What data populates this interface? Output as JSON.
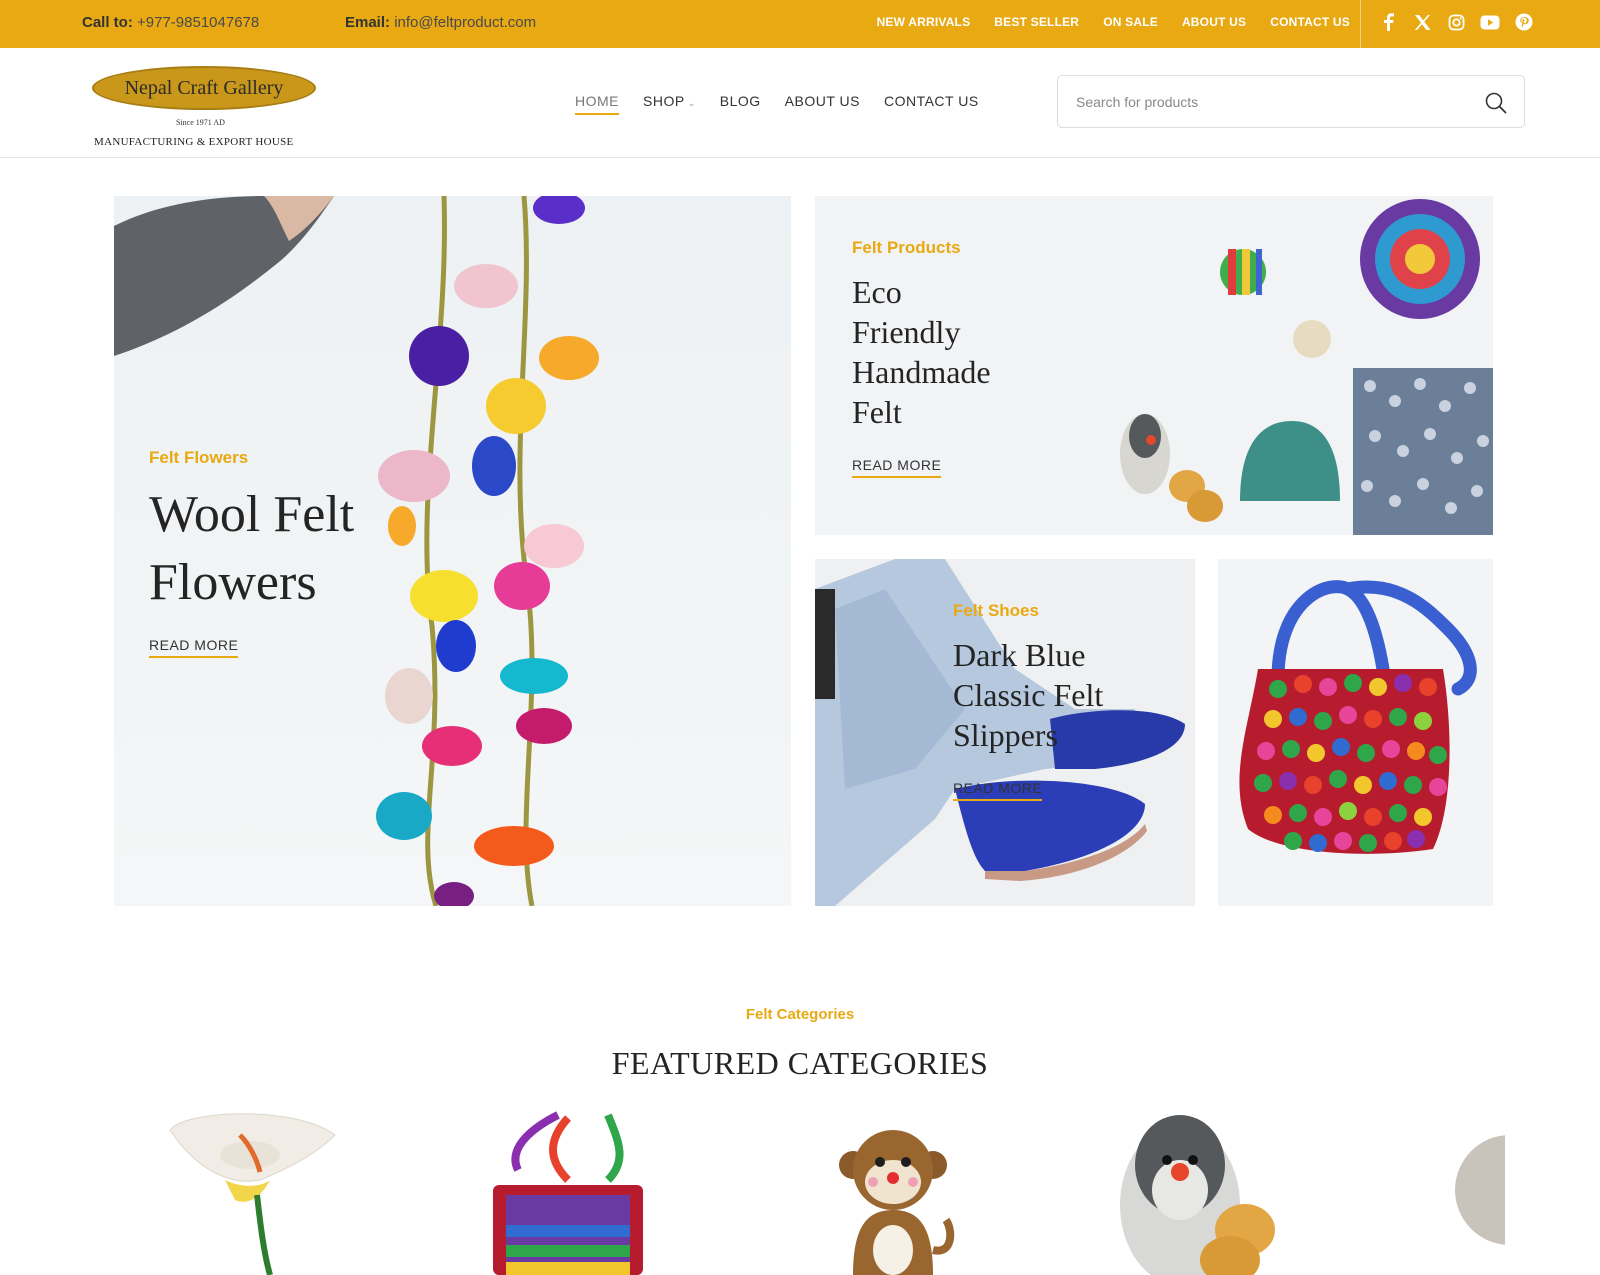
{
  "topbar": {
    "call_label": "Call to:",
    "call_value": "+977-9851047678",
    "email_label": "Email:",
    "email_value": "info@feltproduct.com",
    "links": [
      "NEW ARRIVALS",
      "BEST SELLER",
      "ON SALE",
      "ABOUT US",
      "CONTACT US"
    ],
    "social_icons": [
      "facebook-icon",
      "x-icon",
      "instagram-icon",
      "youtube-icon",
      "pinterest-icon"
    ],
    "background": "#e8a912"
  },
  "logo": {
    "name": "Nepal Craft Gallery",
    "since": "Since 1971 AD",
    "tagline": "MANUFACTURING & EXPORT HOUSE"
  },
  "nav": {
    "home": "HOME",
    "shop": "SHOP",
    "blog": "BLOG",
    "about": "ABOUT US",
    "contact": "CONTACT US"
  },
  "search": {
    "placeholder": "Search for products"
  },
  "banners": {
    "felt_flowers": {
      "kicker": "Felt Flowers",
      "title_line1": "Wool Felt",
      "title_line2": "Flowers",
      "cta": "READ MORE"
    },
    "felt_products": {
      "kicker": "Felt Products",
      "title_lines": [
        "Eco",
        "Friendly",
        "Handmade",
        "Felt"
      ],
      "cta": "READ MORE"
    },
    "felt_shoes": {
      "kicker": "Felt Shoes",
      "title_lines": [
        "Dark Blue",
        "Classic Felt",
        "Slippers"
      ],
      "cta": "READ MORE"
    }
  },
  "featured": {
    "kicker": "Felt Categories",
    "title": "FEATURED CATEGORIES"
  },
  "colors": {
    "accent": "#e8a912",
    "text": "#242424"
  }
}
